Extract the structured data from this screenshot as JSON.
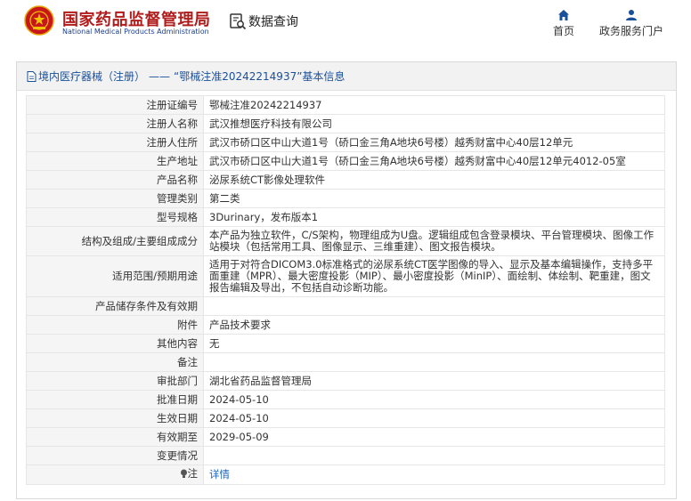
{
  "header": {
    "site_name_cn": "国家药品监督管理局",
    "site_name_en": "National Medical Products Administration",
    "data_query": "数据查询",
    "nav": [
      {
        "label": "首页",
        "icon": "home-icon"
      },
      {
        "label": "政务服务门户",
        "icon": "user-icon"
      }
    ]
  },
  "panel": {
    "crumb": "境内医疗器械（注册）",
    "dash": "——",
    "title": "“鄂械注准20242214937”基本信息"
  },
  "rows": [
    {
      "key": "注册证编号",
      "value": "鄂械注准20242214937"
    },
    {
      "key": "注册人名称",
      "value": "武汉推想医疗科技有限公司"
    },
    {
      "key": "注册人住所",
      "value": "武汉市硚口区中山大道1号（硚口金三角A地块6号楼）越秀财富中心40层12单元"
    },
    {
      "key": "生产地址",
      "value": "武汉市硚口区中山大道1号（硚口金三角A地块6号楼）越秀财富中心40层12单元4012-05室"
    },
    {
      "key": "产品名称",
      "value": "泌尿系统CT影像处理软件"
    },
    {
      "key": "管理类别",
      "value": "第二类"
    },
    {
      "key": "型号规格",
      "value": "3Durinary，发布版本1"
    },
    {
      "key": "结构及组成/主要组成成分",
      "value": "本产品为独立软件，C/S架构，物理组成为U盘。逻辑组成包含登录模块、平台管理模块、图像工作站模块（包括常用工具、图像显示、三维重建）、图文报告模块。"
    },
    {
      "key": "适用范围/预期用途",
      "value": "适用于对符合DICOM3.0标准格式的泌尿系统CT医学图像的导入、显示及基本编辑操作，支持多平面重建（MPR）、最大密度投影（MIP）、最小密度投影（MinIP）、面绘制、体绘制、靶重建，图文报告编辑及导出，不包括自动诊断功能。"
    },
    {
      "key": "产品储存条件及有效期",
      "value": ""
    },
    {
      "key": "附件",
      "value": "产品技术要求"
    },
    {
      "key": "其他内容",
      "value": "无"
    },
    {
      "key": "备注",
      "value": ""
    },
    {
      "key": "审批部门",
      "value": "湖北省药品监督管理局"
    },
    {
      "key": "批准日期",
      "value": "2024-05-10"
    },
    {
      "key": "生效日期",
      "value": "2024-05-10"
    },
    {
      "key": "有效期至",
      "value": "2029-05-09"
    },
    {
      "key": "变更情况",
      "value": ""
    }
  ],
  "note": {
    "key": "注",
    "link_text": "详情",
    "icon": "lightbulb-icon"
  },
  "colors": {
    "brand_red": "#b01c1c",
    "link_blue": "#1a64c0",
    "title_blue": "#1a4f9a"
  }
}
